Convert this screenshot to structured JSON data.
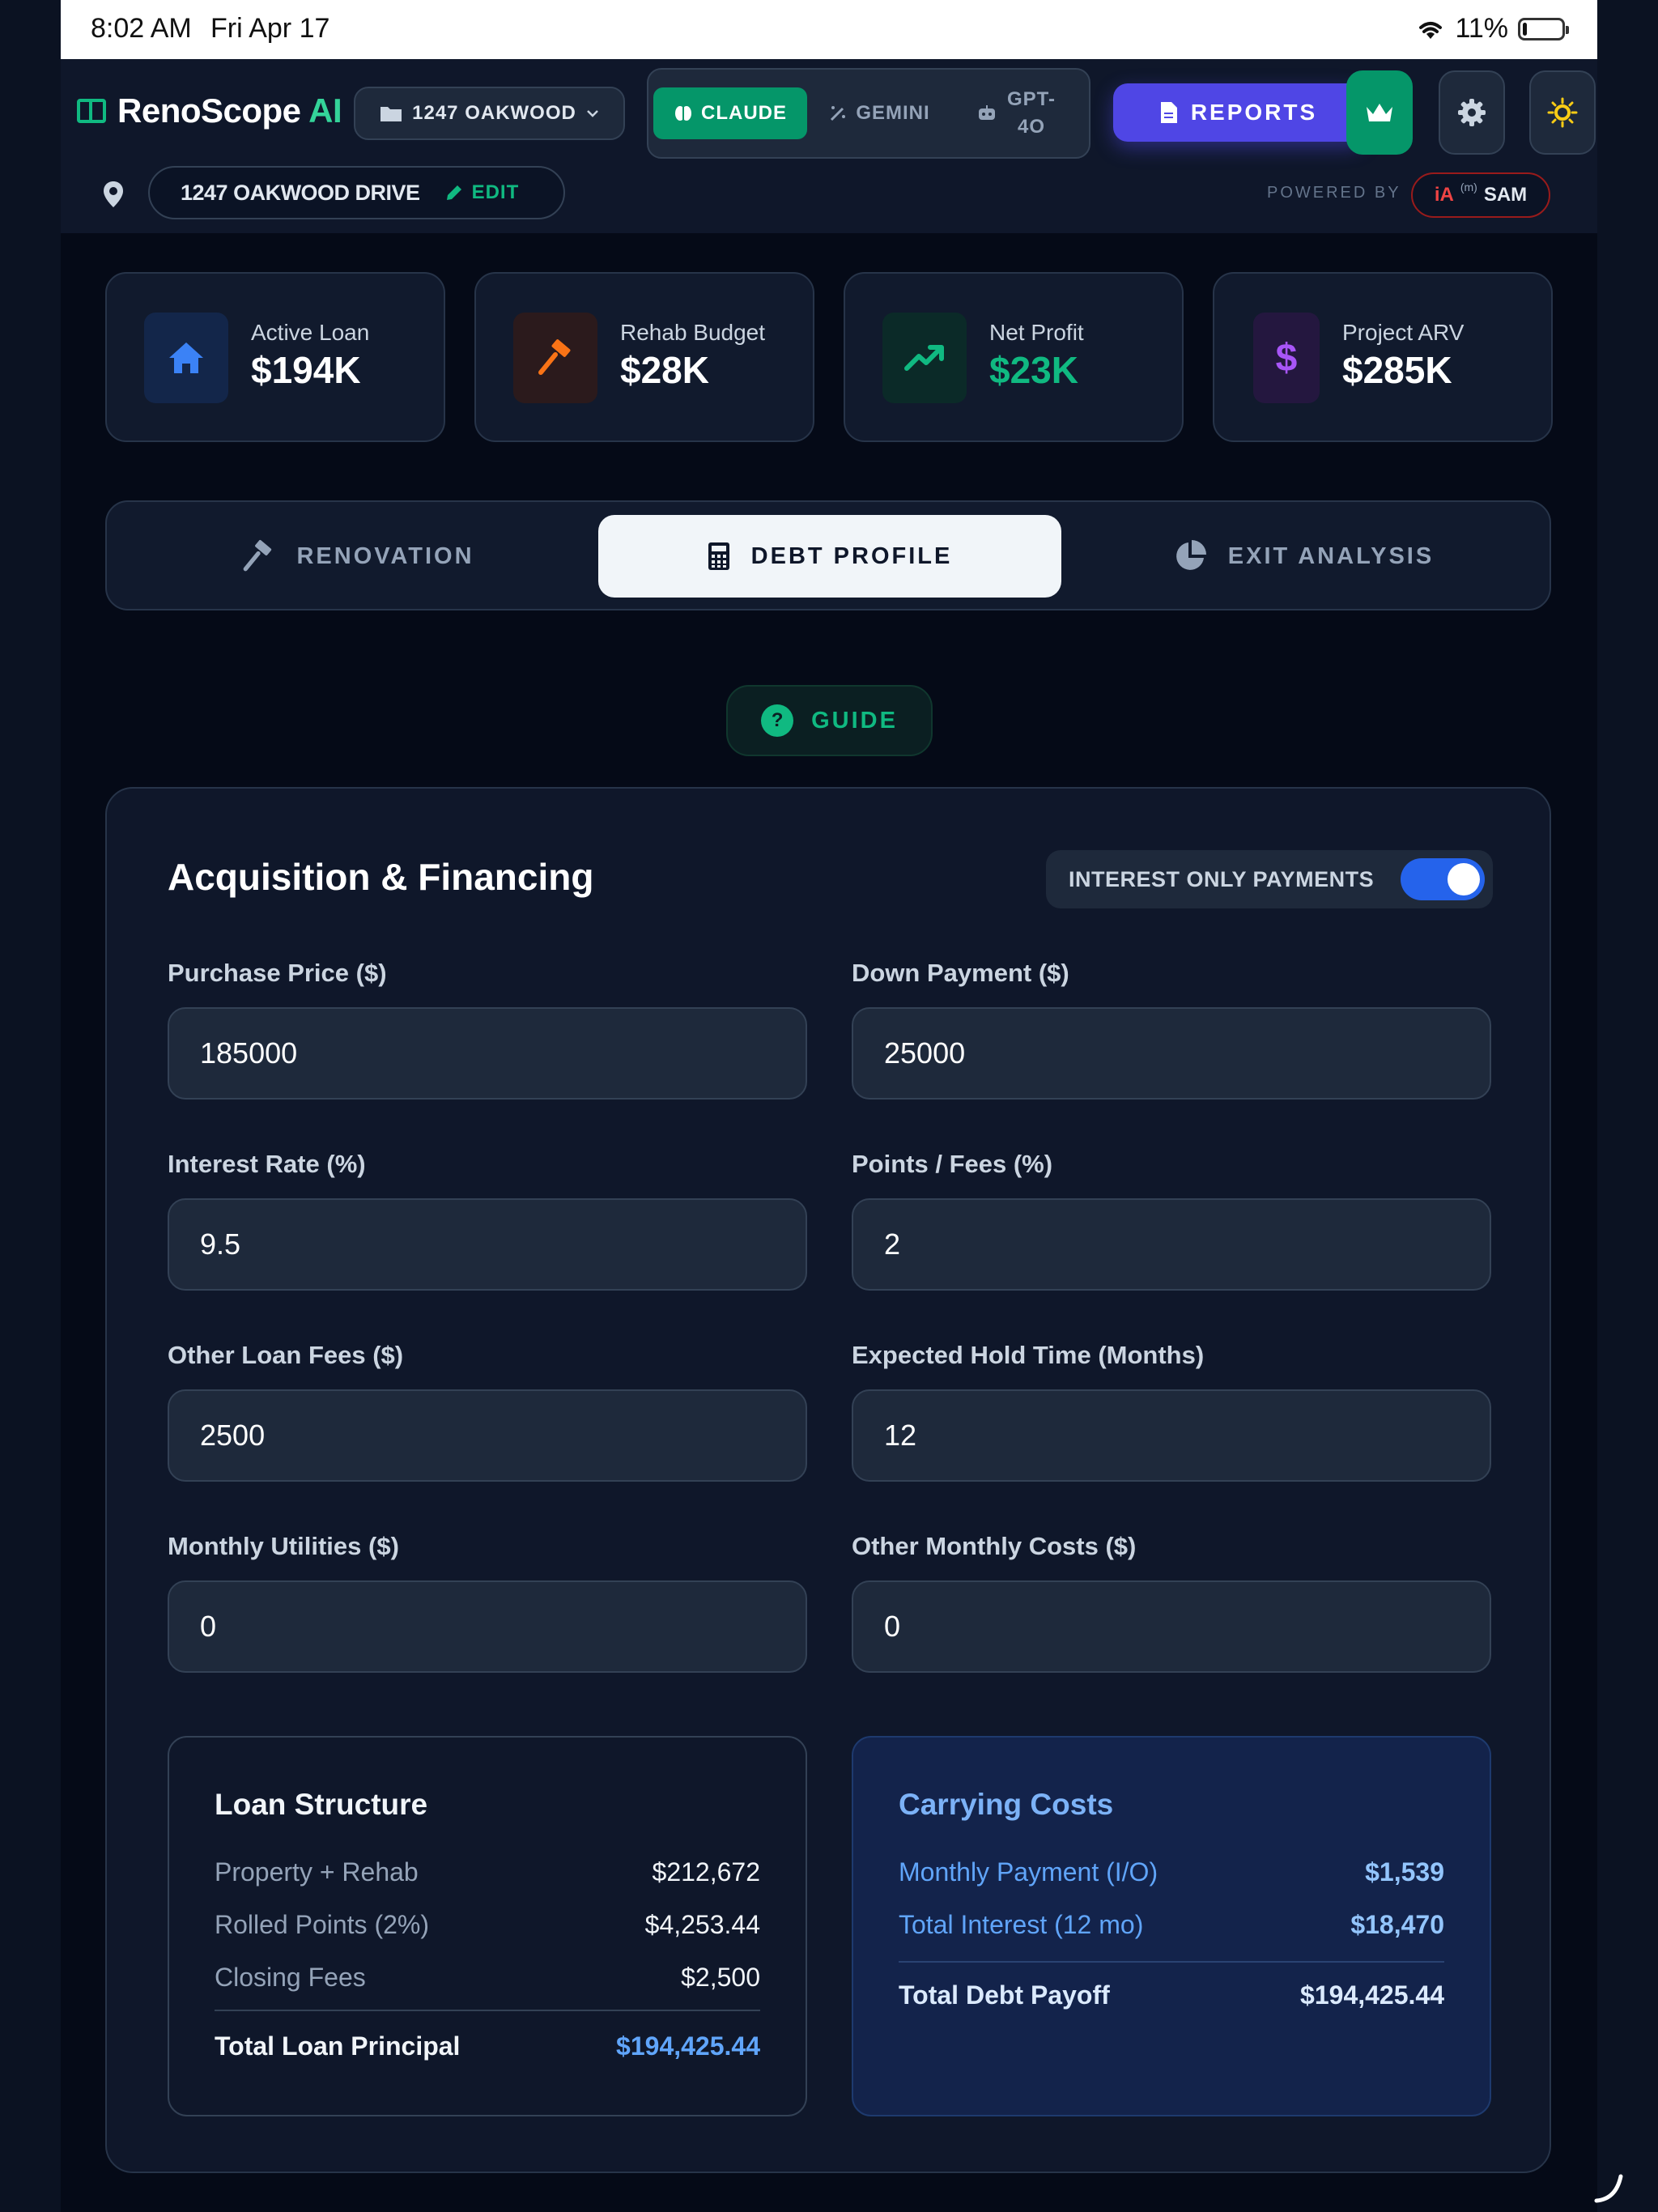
{
  "status_bar": {
    "time": "8:02 AM",
    "date": "Fri Apr 17",
    "battery": "11%",
    "battery_level": 0.11
  },
  "header": {
    "app_name": "RenoScope",
    "app_name_suffix": "AI",
    "project_select": "1247 OAKWOOD",
    "models": [
      {
        "label": "CLAUDE",
        "icon": "brain-icon",
        "active": true
      },
      {
        "label": "GEMINI",
        "icon": "magic-wand-icon",
        "active": false
      },
      {
        "label": "GPT-4O",
        "icon": "robot-icon",
        "active": false
      }
    ],
    "reports_label": "REPORTS",
    "address": "1247 OAKWOOD DRIVE",
    "edit_label": "EDIT",
    "powered_by": "POWERED BY",
    "badge": {
      "ia": "iA",
      "m": "(m)",
      "sam": "SAM"
    }
  },
  "stats": [
    {
      "label": "Active Loan",
      "value": "$194K",
      "icon": "home-icon",
      "color": "#3b82f6"
    },
    {
      "label": "Rehab Budget",
      "value": "$28K",
      "icon": "hammer-icon",
      "color": "#f97316"
    },
    {
      "label": "Net Profit",
      "value": "$23K",
      "icon": "trending-up-icon",
      "color": "#10b981"
    },
    {
      "label": "Project ARV",
      "value": "$285K",
      "icon": "dollar-icon",
      "color": "#a855f7"
    }
  ],
  "tabs": [
    {
      "label": "RENOVATION",
      "icon": "hammer-icon",
      "active": false
    },
    {
      "label": "DEBT PROFILE",
      "icon": "calculator-icon",
      "active": true
    },
    {
      "label": "EXIT ANALYSIS",
      "icon": "pie-chart-icon",
      "active": false
    }
  ],
  "guide_label": "GUIDE",
  "panel": {
    "title": "Acquisition & Financing",
    "toggle_label": "INTEREST ONLY PAYMENTS",
    "toggle_on": true,
    "fields": [
      {
        "label": "Purchase Price ($)",
        "value": "185000"
      },
      {
        "label": "Down Payment ($)",
        "value": "25000"
      },
      {
        "label": "Interest Rate (%)",
        "value": "9.5"
      },
      {
        "label": "Points / Fees (%)",
        "value": "2"
      },
      {
        "label": "Other Loan Fees ($)",
        "value": "2500"
      },
      {
        "label": "Expected Hold Time (Months)",
        "value": "12"
      },
      {
        "label": "Monthly Utilities ($)",
        "value": "0"
      },
      {
        "label": "Other Monthly Costs ($)",
        "value": "0"
      }
    ],
    "loan_structure": {
      "title": "Loan Structure",
      "rows": [
        {
          "label": "Property + Rehab",
          "value": "$212,672"
        },
        {
          "label": "Rolled Points (2%)",
          "value": "$4,253.44"
        },
        {
          "label": "Closing Fees",
          "value": "$2,500"
        }
      ],
      "total_label": "Total Loan Principal",
      "total_value": "$194,425.44"
    },
    "carrying_costs": {
      "title": "Carrying Costs",
      "rows": [
        {
          "label": "Monthly Payment (I/O)",
          "value": "$1,539"
        },
        {
          "label": "Total Interest (12 mo)",
          "value": "$18,470"
        }
      ],
      "total_label": "Total Debt Payoff",
      "total_value": "$194,425.44"
    }
  }
}
